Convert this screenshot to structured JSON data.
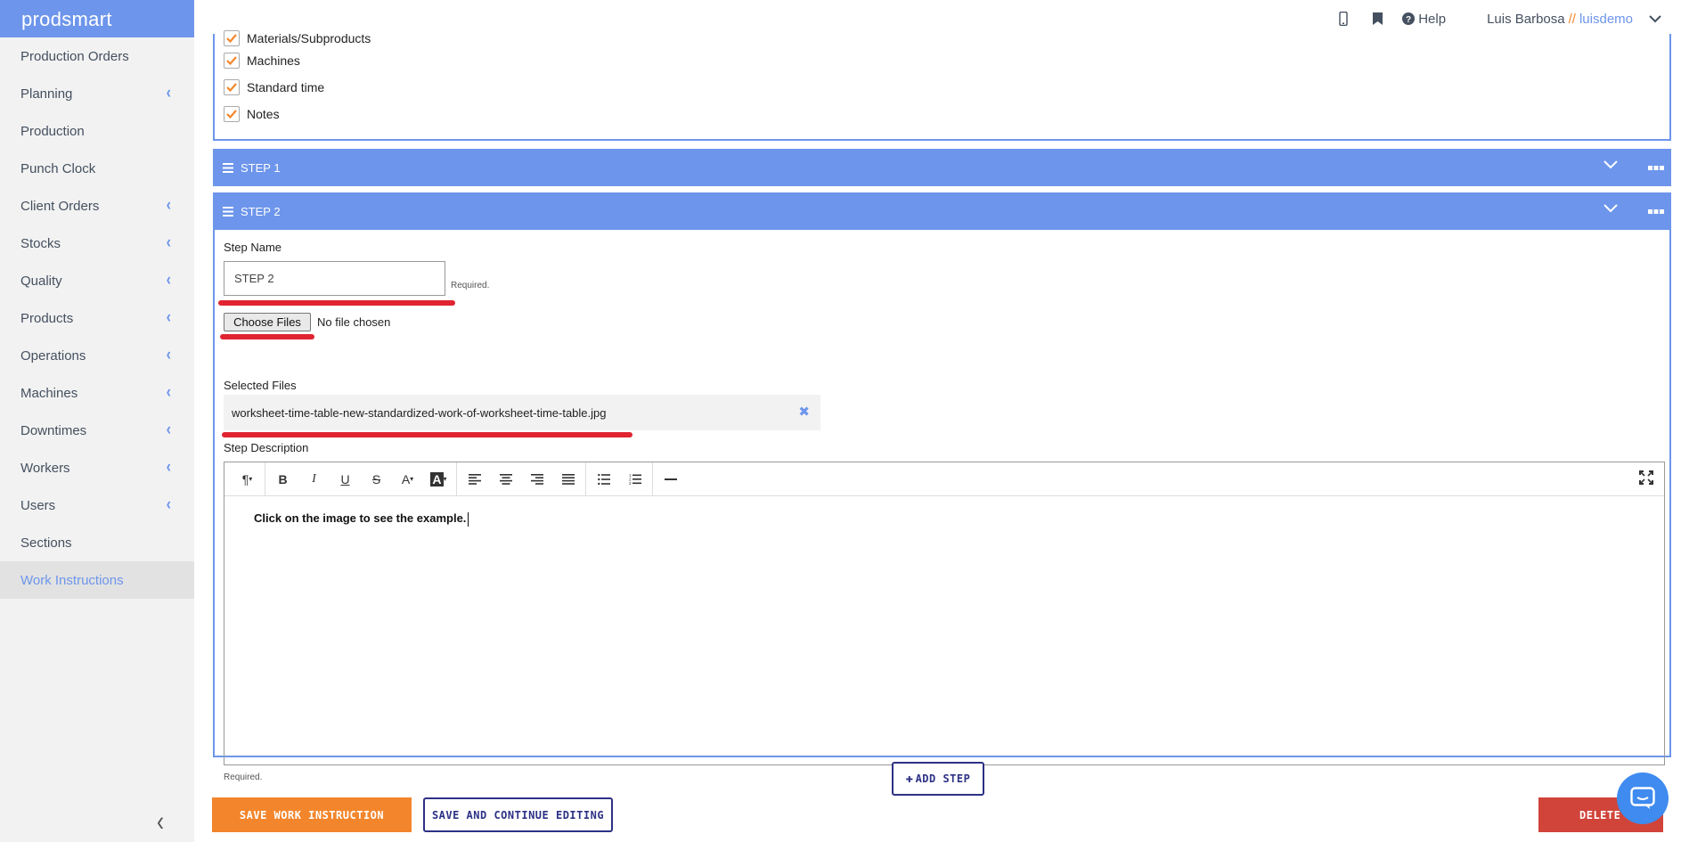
{
  "app": {
    "brand": "prodsmart"
  },
  "sidebar": {
    "items": [
      {
        "label": "Production Orders",
        "has_submenu": false
      },
      {
        "label": "Planning",
        "has_submenu": true
      },
      {
        "label": "Production",
        "has_submenu": false
      },
      {
        "label": "Punch Clock",
        "has_submenu": false
      },
      {
        "label": "Client Orders",
        "has_submenu": true
      },
      {
        "label": "Stocks",
        "has_submenu": true
      },
      {
        "label": "Quality",
        "has_submenu": true
      },
      {
        "label": "Products",
        "has_submenu": true
      },
      {
        "label": "Operations",
        "has_submenu": true
      },
      {
        "label": "Machines",
        "has_submenu": true
      },
      {
        "label": "Downtimes",
        "has_submenu": true
      },
      {
        "label": "Workers",
        "has_submenu": true
      },
      {
        "label": "Users",
        "has_submenu": true
      },
      {
        "label": "Sections",
        "has_submenu": false
      },
      {
        "label": "Work Instructions",
        "has_submenu": false,
        "active": true
      }
    ]
  },
  "topbar": {
    "help_label": "Help",
    "user_name": "Luis Barbosa",
    "separator": "//",
    "account": "luisdemo",
    "icons": [
      "mobile-icon",
      "bookmark-icon",
      "question-circle-icon",
      "chevron-down-icon"
    ]
  },
  "options": {
    "items": [
      {
        "label": "Materials/Subproducts",
        "checked": true
      },
      {
        "label": "Machines",
        "checked": true
      },
      {
        "label": "Standard time",
        "checked": true
      },
      {
        "label": "Notes",
        "checked": true
      }
    ]
  },
  "steps": [
    {
      "title": "STEP 1",
      "expanded": false
    },
    {
      "title": "STEP 2",
      "expanded": true
    }
  ],
  "step_form": {
    "name_label": "Step Name",
    "name_value": "STEP 2",
    "required_text": "Required.",
    "choose_files_label": "Choose Files",
    "no_file_text": "No file chosen",
    "selected_files_label": "Selected Files",
    "selected_file": "worksheet-time-table-new-standardized-work-of-worksheet-time-table.jpg",
    "description_label": "Step Description",
    "description_text": "Click on the image to see the example.",
    "description_required": "Required."
  },
  "actions": {
    "add_step": "ADD STEP",
    "save": "SAVE WORK INSTRUCTION",
    "save_continue": "SAVE AND CONTINUE EDITING",
    "delete": "DELETE"
  },
  "colors": {
    "accent": "#6d95eb",
    "orange": "#f3862c",
    "navy": "#2d3185",
    "danger": "#d1443a",
    "annotation_red": "#e02431"
  }
}
